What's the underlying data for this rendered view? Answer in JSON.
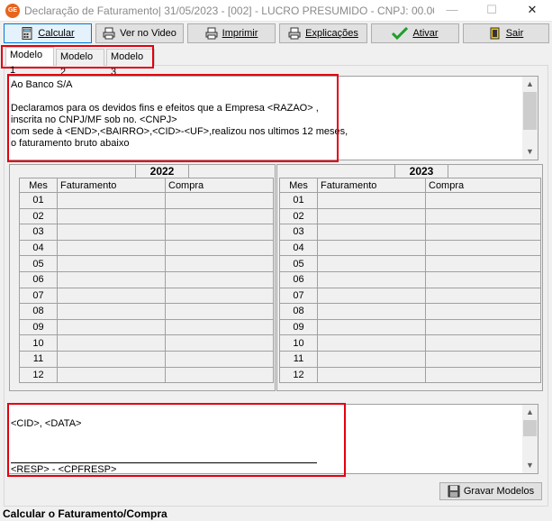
{
  "window": {
    "icon_text": "GE",
    "title": "Declaração de Faturamento| 31/05/2023 - [002] - LUCRO PRESUMIDO - CNPJ: 00.00...",
    "minimize": "—",
    "maximize": "☐",
    "close": "✕"
  },
  "toolbar": {
    "calcular": "Calcular",
    "ver_video": "Ver no Video",
    "imprimir": "Imprimir",
    "explicacoes": "Explicações",
    "ativar": "Ativar",
    "sair": "Sair"
  },
  "tabs": [
    "Modelo 1",
    "Modelo 2",
    "Modelo 3"
  ],
  "header_memo": "Ao Banco S/A\n\nDeclaramos para os devidos fins e efeitos que a Empresa <RAZAO> ,\ninscrita no CNPJ/MF sob no. <CNPJ>\ncom sede à <END>,<BAIRRO>,<CID>-<UF>,realizou nos ultimos 12 meses,\no faturamento bruto abaixo",
  "years": [
    "2022",
    "2023"
  ],
  "columns": {
    "mes": "Mes",
    "faturamento": "Faturamento",
    "compra": "Compra"
  },
  "months": [
    "01",
    "02",
    "03",
    "04",
    "05",
    "06",
    "07",
    "08",
    "09",
    "10",
    "11",
    "12"
  ],
  "footer_memo": {
    "line1": "<CID>, <DATA>",
    "signature": "<RESP> - <CPFRESP>"
  },
  "gravar_button": "Gravar Modelos",
  "status": "Calcular o Faturamento/Compra",
  "colors": {
    "highlight_box": "#e3000f",
    "focus_border": "#0078d7"
  }
}
